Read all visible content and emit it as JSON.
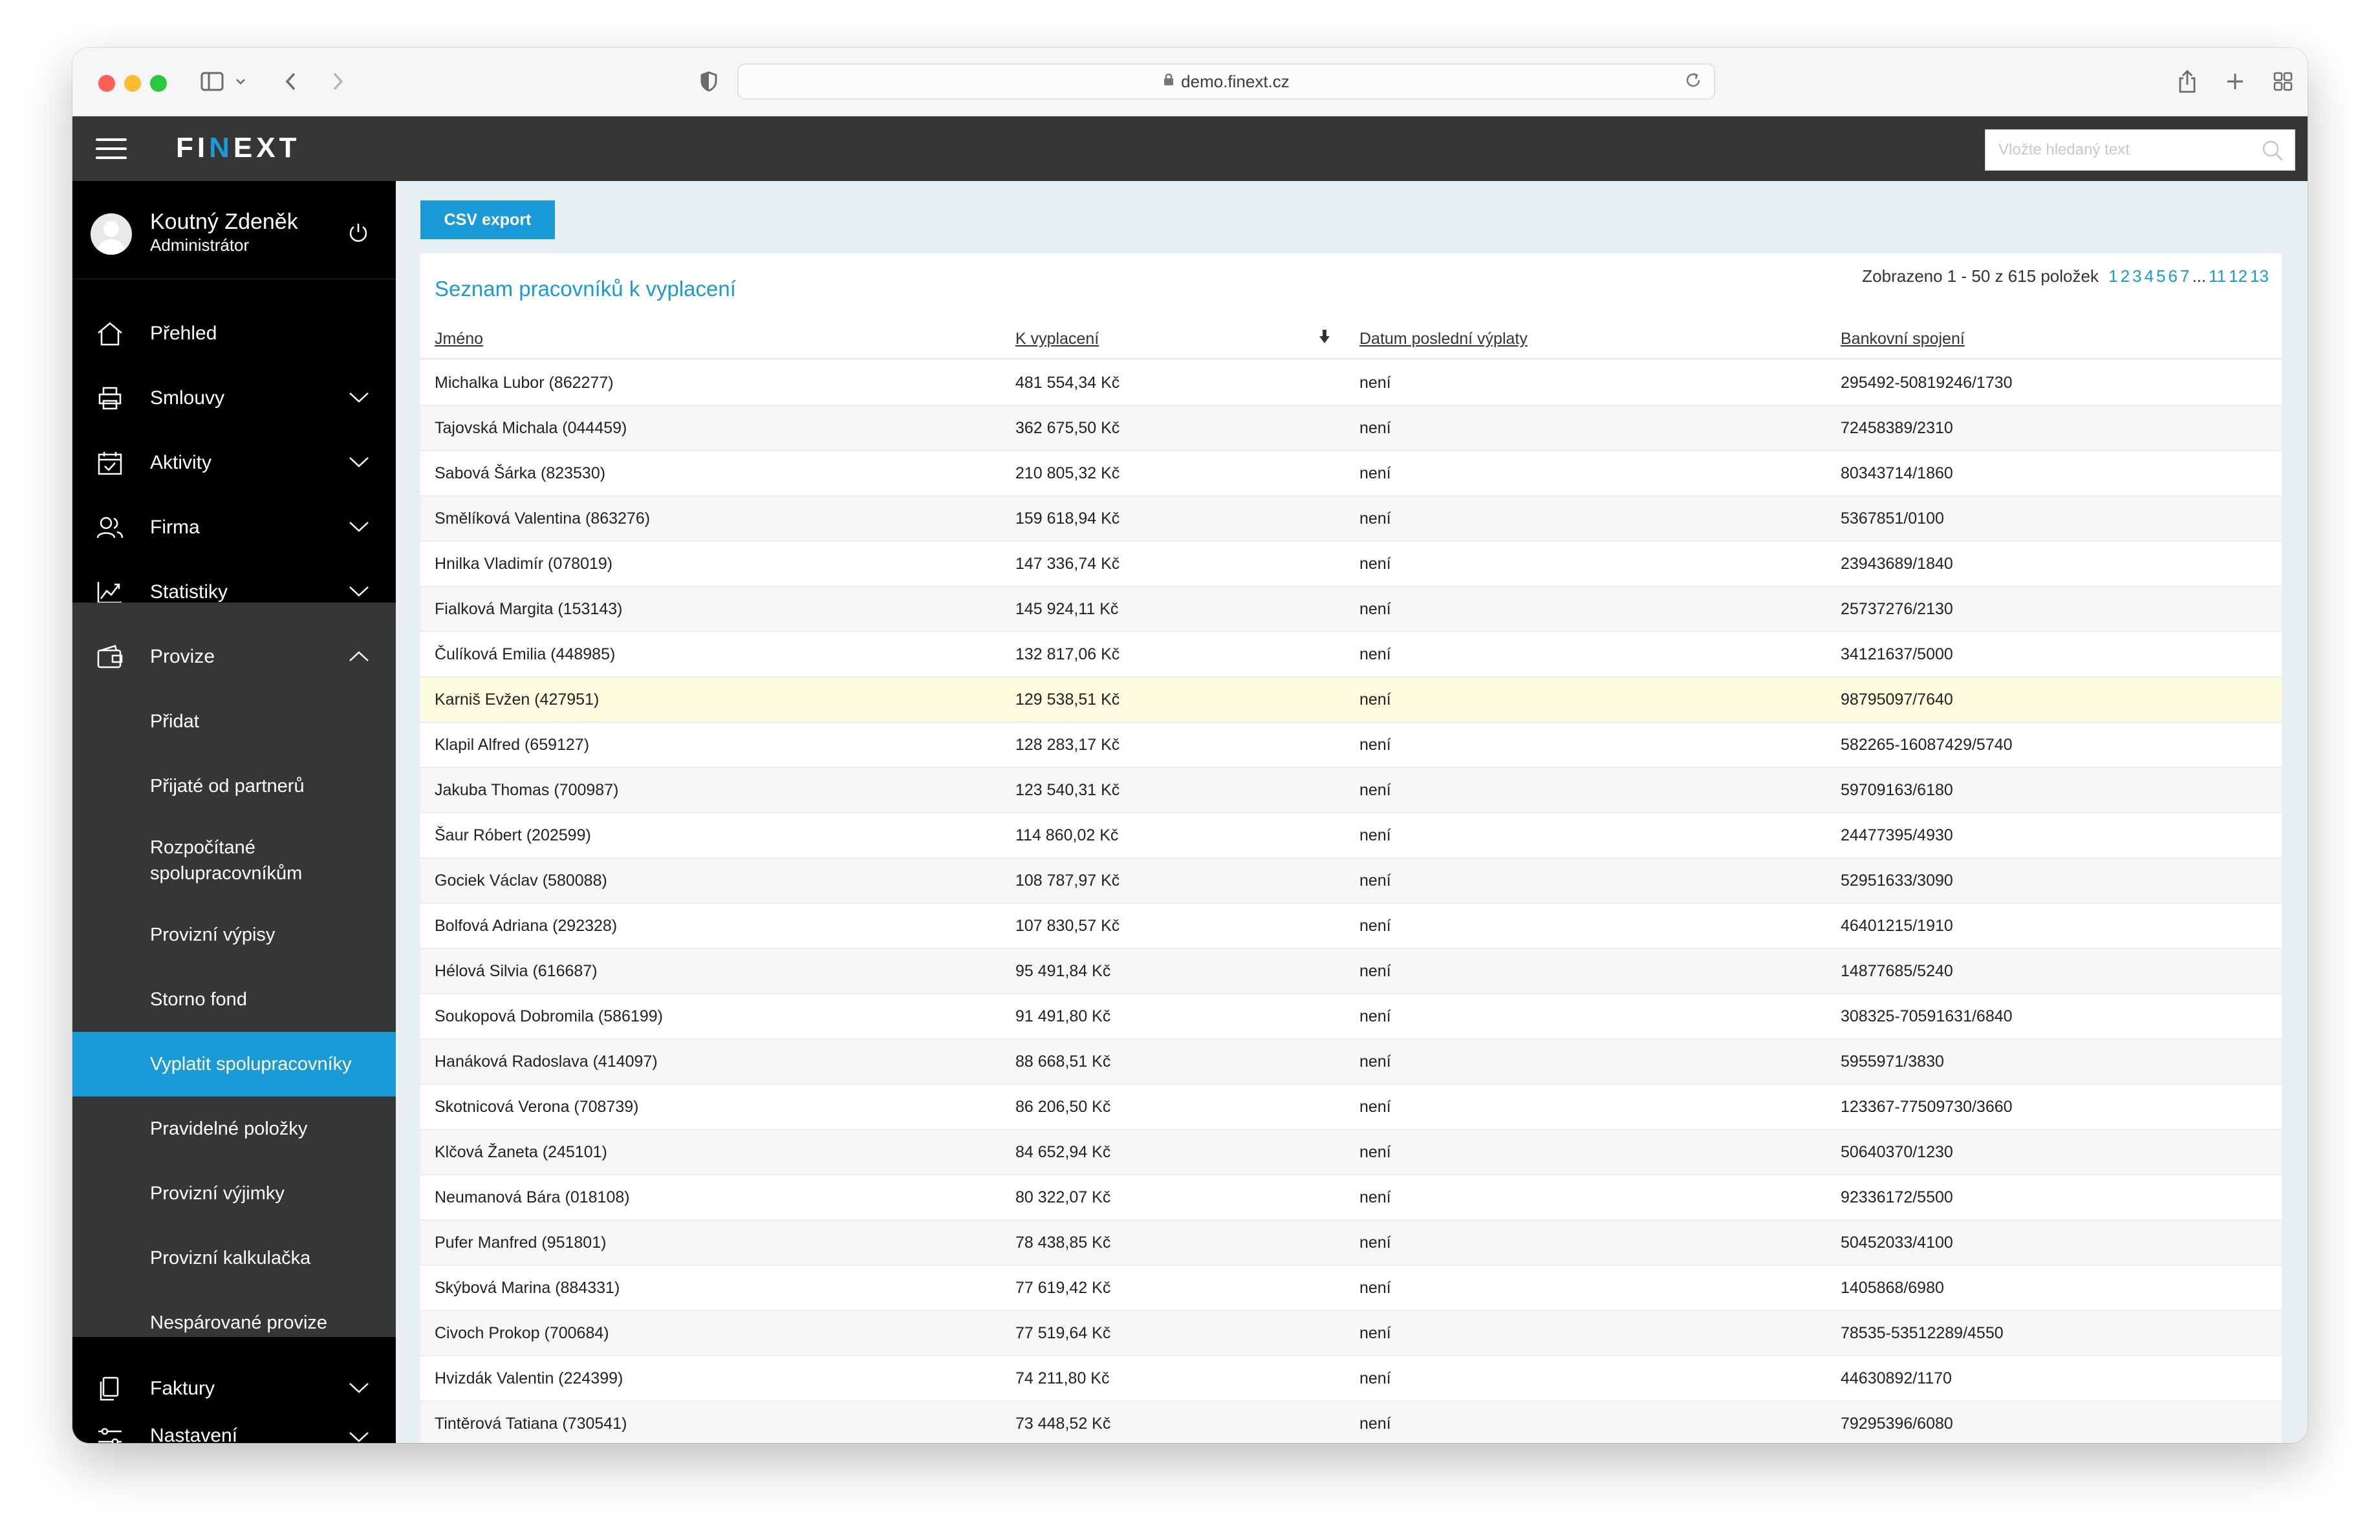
{
  "browser": {
    "url": "demo.finext.cz"
  },
  "app": {
    "logo_prefix": "FI",
    "logo_accent": "N",
    "logo_suffix": "EXT",
    "search_placeholder": "Vložte hledaný text",
    "accent_color": "#1a9ad6"
  },
  "user": {
    "name": "Koutný Zdeněk",
    "role": "Administrátor"
  },
  "nav": {
    "prehled": "Přehled",
    "smlouvy": "Smlouvy",
    "aktivity": "Aktivity",
    "firma": "Firma",
    "statistiky": "Statistiky",
    "provize": "Provize",
    "faktury": "Faktury",
    "nastaveni": "Nastavení"
  },
  "provize_sub": [
    "Přidat",
    "Přijaté od partnerů",
    "Rozpočítané spolupracovníkům",
    "Provizní výpisy",
    "Storno fond",
    "Vyplatit spolupracovníky",
    "Pravidelné položky",
    "Provizní výjimky",
    "Provizní kalkulačka",
    "Nespárované provize"
  ],
  "toolbar": {
    "csv_export": "CSV export"
  },
  "panel": {
    "title": "Seznam pracovníků k vyplacení",
    "pagination_text": "Zobrazeno 1 - 50 z 615 položek",
    "pages": [
      "1",
      "2",
      "3",
      "4",
      "5",
      "6",
      "7"
    ],
    "ellipsis": "...",
    "last_pages": [
      "11",
      "12",
      "13"
    ]
  },
  "table": {
    "columns": [
      "Jméno",
      "K vyplacení",
      "Datum poslední výplaty",
      "Bankovní spojení"
    ],
    "rows": [
      [
        "Michalka Lubor (862277)",
        "481 554,34 Kč",
        "není",
        "295492-50819246/1730"
      ],
      [
        "Tajovská Michala (044459)",
        "362 675,50 Kč",
        "není",
        "72458389/2310"
      ],
      [
        "Sabová Šárka (823530)",
        "210 805,32 Kč",
        "není",
        "80343714/1860"
      ],
      [
        "Smělíková Valentina (863276)",
        "159 618,94 Kč",
        "není",
        "5367851/0100"
      ],
      [
        "Hnilka Vladimír (078019)",
        "147 336,74 Kč",
        "není",
        "23943689/1840"
      ],
      [
        "Fialková Margita (153143)",
        "145 924,11 Kč",
        "není",
        "25737276/2130"
      ],
      [
        "Čulíková Emilia (448985)",
        "132 817,06 Kč",
        "není",
        "34121637/5000"
      ],
      [
        "Karniš Evžen (427951)",
        "129 538,51 Kč",
        "není",
        "98795097/7640"
      ],
      [
        "Klapil Alfred (659127)",
        "128 283,17 Kč",
        "není",
        "582265-16087429/5740"
      ],
      [
        "Jakuba Thomas (700987)",
        "123 540,31 Kč",
        "není",
        "59709163/6180"
      ],
      [
        "Šaur Róbert (202599)",
        "114 860,02 Kč",
        "není",
        "24477395/4930"
      ],
      [
        "Gociek Václav (580088)",
        "108 787,97 Kč",
        "není",
        "52951633/3090"
      ],
      [
        "Bolfová Adriana (292328)",
        "107 830,57 Kč",
        "není",
        "46401215/1910"
      ],
      [
        "Hélová Silvia (616687)",
        "95 491,84 Kč",
        "není",
        "14877685/5240"
      ],
      [
        "Soukopová Dobromila (586199)",
        "91 491,80 Kč",
        "není",
        "308325-70591631/6840"
      ],
      [
        "Hanáková Radoslava (414097)",
        "88 668,51 Kč",
        "není",
        "5955971/3830"
      ],
      [
        "Skotnicová Verona (708739)",
        "86 206,50 Kč",
        "není",
        "123367-77509730/3660"
      ],
      [
        "Klčová Žaneta (245101)",
        "84 652,94 Kč",
        "není",
        "50640370/1230"
      ],
      [
        "Neumanová Bára (018108)",
        "80 322,07 Kč",
        "není",
        "92336172/5500"
      ],
      [
        "Pufer Manfred (951801)",
        "78 438,85 Kč",
        "není",
        "50452033/4100"
      ],
      [
        "Skýbová Marina (884331)",
        "77 619,42 Kč",
        "není",
        "1405868/6980"
      ],
      [
        "Civoch Prokop (700684)",
        "77 519,64 Kč",
        "není",
        "78535-53512289/4550"
      ],
      [
        "Hvizdák Valentin (224399)",
        "74 211,80 Kč",
        "není",
        "44630892/1170"
      ],
      [
        "Tintěrová Tatiana (730541)",
        "73 448,52 Kč",
        "není",
        "79295396/6080"
      ]
    ]
  }
}
